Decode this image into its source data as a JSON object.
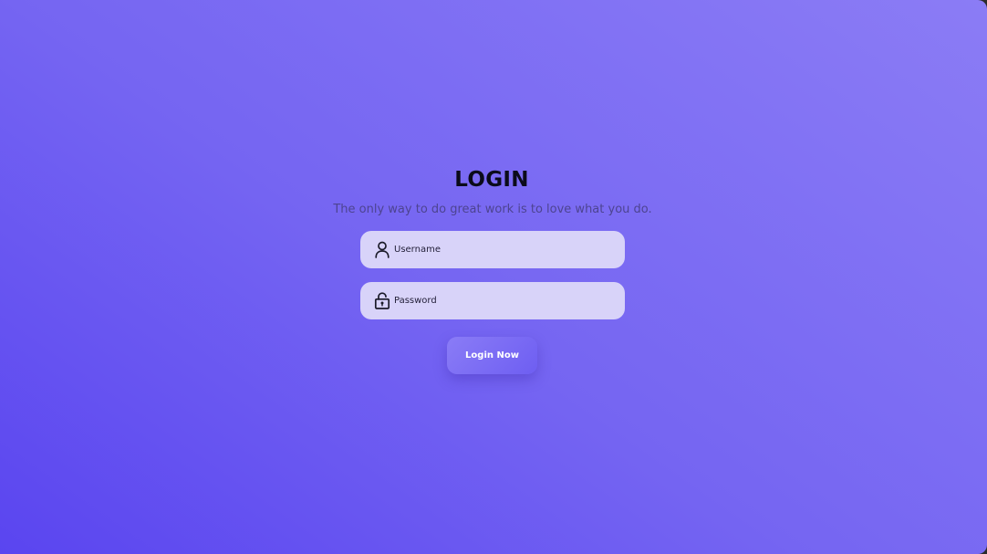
{
  "login": {
    "title": "LOGIN",
    "subtitle": "The only way to do great work is to love what you do.",
    "username_field": {
      "placeholder": "Username",
      "value": "",
      "icon": "user-icon"
    },
    "password_field": {
      "placeholder": "Password",
      "value": "",
      "icon": "lock-icon"
    },
    "submit_label": "Login Now"
  },
  "colors": {
    "background_gradient_start": "#5a45f0",
    "background_gradient_end": "#8b7cf5",
    "field_background": "#d8d3f9",
    "button_background": "#7b6cf4",
    "title_color": "#0b0b1a",
    "subtitle_color": "#4d4490"
  }
}
